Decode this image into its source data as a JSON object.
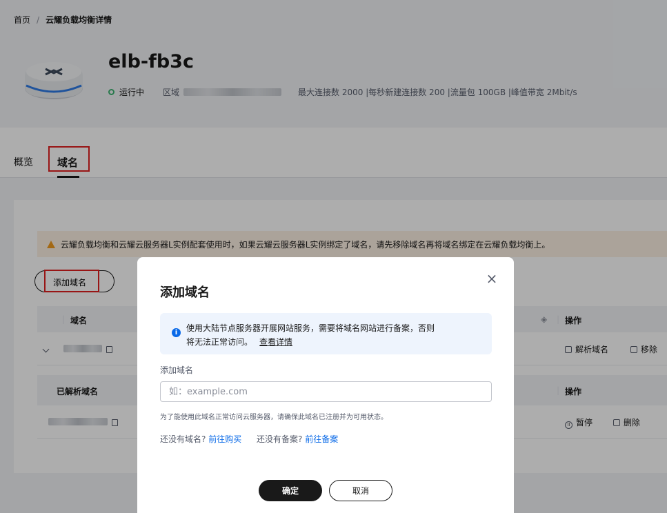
{
  "breadcrumb": {
    "home": "首页",
    "separator": "/",
    "current": "云耀负载均衡详情"
  },
  "instance": {
    "name": "elb-fb3c",
    "status": "运行中",
    "region_label": "区域",
    "specs": "最大连接数 2000 |每秒新建连接数 200 |流量包 100GB |峰值带宽 2Mbit/s"
  },
  "tabs": [
    {
      "label": "概览"
    },
    {
      "label": "域名"
    }
  ],
  "warning": {
    "text": "云耀负载均衡和云耀云服务器L实例配套使用时，如果云耀云服务器L实例绑定了域名，请先移除域名再将域名绑定在云耀负载均衡上。"
  },
  "toolbar": {
    "add_label": "添加域名"
  },
  "table": {
    "col_domain": "域名",
    "col_action": "操作",
    "row_actions": {
      "resolve": "解析域名",
      "remove": "移除"
    },
    "sub_col_domain": "已解析域名",
    "sub_col_action": "操作",
    "sub_actions": {
      "pause": "暂停",
      "delete": "删除"
    }
  },
  "modal": {
    "title": "添加域名",
    "info_line1": "使用大陆节点服务器开展网站服务，需要将域名网站进行备案，否则",
    "info_line2": "将无法正常访问。",
    "info_link": "查看详情",
    "field_label": "添加域名",
    "field_placeholder": "如：example.com",
    "hint": "为了能使用此域名正常访问云服务器，请确保此域名已注册并为可用状态。",
    "no_domain": "还没有域名?",
    "buy_link": "前往购买",
    "no_filing": "还没有备案?",
    "filing_link": "前往备案",
    "ok": "确定",
    "cancel": "取消"
  },
  "colors": {
    "accent": "#0a6ae8",
    "status_green": "#3cb371",
    "highlight_red": "#e02020",
    "warning_icon": "#f19b1f"
  }
}
